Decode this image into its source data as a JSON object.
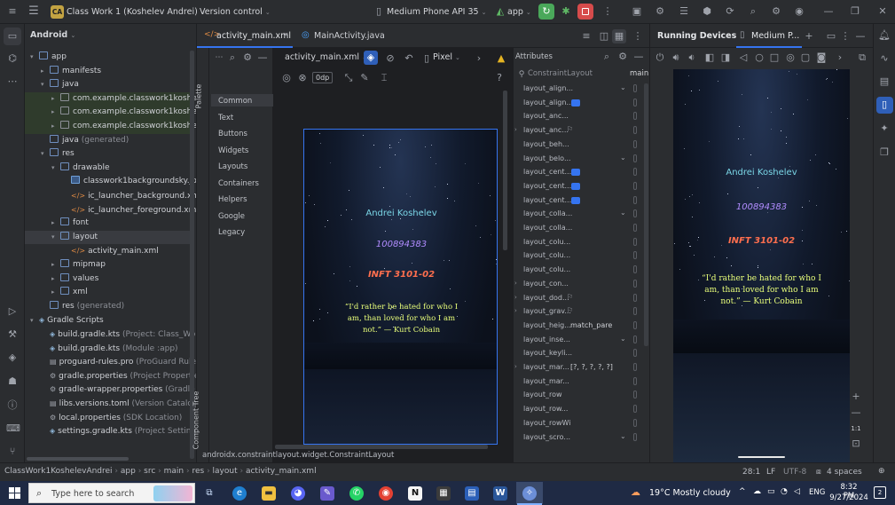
{
  "titlebar": {
    "project_badge": "CA",
    "project_name": "Class Work 1 (Koshelev Andrei)",
    "vcs": "Version control",
    "device": "Medium Phone API 35",
    "run_config": "app"
  },
  "project_panel": {
    "view": "Android",
    "items": [
      {
        "label": "app",
        "indent": 0,
        "arrow": "open",
        "kind": "folder"
      },
      {
        "label": "manifests",
        "indent": 1,
        "arrow": "closed",
        "kind": "folder"
      },
      {
        "label": "java",
        "indent": 1,
        "arrow": "open",
        "kind": "folder"
      },
      {
        "label": "com.example.classwork1koshelev",
        "indent": 2,
        "arrow": "closed",
        "kind": "pkg",
        "hl": true
      },
      {
        "label": "com.example.classwork1koshelev",
        "indent": 2,
        "arrow": "closed",
        "kind": "pkg",
        "hl": true
      },
      {
        "label": "com.example.classwork1koshelev",
        "indent": 2,
        "arrow": "closed",
        "kind": "pkg",
        "hl": true
      },
      {
        "label": "java",
        "suffix": "(generated)",
        "indent": 1,
        "arrow": "none",
        "kind": "folder"
      },
      {
        "label": "res",
        "indent": 1,
        "arrow": "open",
        "kind": "folder"
      },
      {
        "label": "drawable",
        "indent": 2,
        "arrow": "open",
        "kind": "folder"
      },
      {
        "label": "classwork1backgroundsky.jpg",
        "indent": 3,
        "arrow": "none",
        "kind": "img"
      },
      {
        "label": "ic_launcher_background.xml",
        "indent": 3,
        "arrow": "none",
        "kind": "xml"
      },
      {
        "label": "ic_launcher_foreground.xml",
        "indent": 3,
        "arrow": "none",
        "kind": "xml"
      },
      {
        "label": "font",
        "indent": 2,
        "arrow": "closed",
        "kind": "folder"
      },
      {
        "label": "layout",
        "indent": 2,
        "arrow": "open",
        "kind": "folder",
        "sel": true
      },
      {
        "label": "activity_main.xml",
        "indent": 3,
        "arrow": "none",
        "kind": "xml"
      },
      {
        "label": "mipmap",
        "indent": 2,
        "arrow": "closed",
        "kind": "folder"
      },
      {
        "label": "values",
        "indent": 2,
        "arrow": "closed",
        "kind": "folder"
      },
      {
        "label": "xml",
        "indent": 2,
        "arrow": "closed",
        "kind": "folder"
      },
      {
        "label": "res",
        "suffix": "(generated)",
        "indent": 1,
        "arrow": "none",
        "kind": "folder"
      },
      {
        "label": "Gradle Scripts",
        "indent": 0,
        "arrow": "open",
        "kind": "gradle"
      },
      {
        "label": "build.gradle.kts",
        "suffix": "(Project: Class_Work",
        "indent": 1,
        "arrow": "none",
        "kind": "gradle"
      },
      {
        "label": "build.gradle.kts",
        "suffix": "(Module :app)",
        "indent": 1,
        "arrow": "none",
        "kind": "gradle"
      },
      {
        "label": "proguard-rules.pro",
        "suffix": "(ProGuard Rules",
        "indent": 1,
        "arrow": "none",
        "kind": "file"
      },
      {
        "label": "gradle.properties",
        "suffix": "(Project Properties",
        "indent": 1,
        "arrow": "none",
        "kind": "gear"
      },
      {
        "label": "gradle-wrapper.properties",
        "suffix": "(Gradle V",
        "indent": 1,
        "arrow": "none",
        "kind": "gear"
      },
      {
        "label": "libs.versions.toml",
        "suffix": "(Version Catalog",
        "indent": 1,
        "arrow": "none",
        "kind": "file"
      },
      {
        "label": "local.properties",
        "suffix": "(SDK Location)",
        "indent": 1,
        "arrow": "none",
        "kind": "gear"
      },
      {
        "label": "settings.gradle.kts",
        "suffix": "(Project Settings",
        "indent": 1,
        "arrow": "none",
        "kind": "gradle"
      }
    ]
  },
  "editor": {
    "tabs": [
      {
        "label": "activity_main.xml",
        "active": true
      },
      {
        "label": "MainActivity.java",
        "active": false
      }
    ],
    "palette_label": "Palette",
    "component_tree_label": "Component Tree",
    "palette": [
      "Common",
      "Text",
      "Buttons",
      "Widgets",
      "Layouts",
      "Containers",
      "Helpers",
      "Google",
      "Legacy"
    ],
    "toolbar_file": "activity_main.xml",
    "toolbar_device": "Pixel",
    "margin": "0dp",
    "breadcrumb": "androidx.constraintlayout.widget.ConstraintLayout"
  },
  "attributes": {
    "title": "Attributes",
    "class_name": "ConstraintLayout",
    "id_value": "main",
    "rows": [
      {
        "name": "layout_align...",
        "ctrl": "chev"
      },
      {
        "name": "layout_align...",
        "ctrl": "check"
      },
      {
        "name": "layout_anc...",
        "ctrl": "box"
      },
      {
        "name": "layout_anc...",
        "ctrl": "flag",
        "expand": true
      },
      {
        "name": "layout_beh...",
        "ctrl": "box"
      },
      {
        "name": "layout_belo...",
        "ctrl": "chev"
      },
      {
        "name": "layout_cent...",
        "ctrl": "check"
      },
      {
        "name": "layout_cent...",
        "ctrl": "check"
      },
      {
        "name": "layout_cent...",
        "ctrl": "check"
      },
      {
        "name": "layout_colla...",
        "ctrl": "chev"
      },
      {
        "name": "layout_colla...",
        "ctrl": "box"
      },
      {
        "name": "layout_colu...",
        "ctrl": "box"
      },
      {
        "name": "layout_colu...",
        "ctrl": "box"
      },
      {
        "name": "layout_colu...",
        "ctrl": "box"
      },
      {
        "name": "layout_con...",
        "ctrl": "box",
        "expand": true
      },
      {
        "name": "layout_dod...",
        "ctrl": "flag",
        "expand": true
      },
      {
        "name": "layout_grav...",
        "ctrl": "flag",
        "expand": true
      },
      {
        "name": "layout_heig...",
        "ctrl": "value",
        "value": "match_pare"
      },
      {
        "name": "layout_inse...",
        "ctrl": "chev"
      },
      {
        "name": "layout_keyli...",
        "ctrl": "box"
      },
      {
        "name": "layout_mar...",
        "ctrl": "value",
        "value": "[?, ?, ?, ?, ?]",
        "expand": true
      },
      {
        "name": "layout_mar...",
        "ctrl": "box"
      },
      {
        "name": "layout_row",
        "ctrl": "box"
      },
      {
        "name": "layout_row...",
        "ctrl": "box"
      },
      {
        "name": "layout_rowWi",
        "ctrl": "box"
      },
      {
        "name": "layout_scro...",
        "ctrl": "chev"
      }
    ]
  },
  "phone_content": {
    "name": "Andrei Koshelev",
    "student_id": "100894383",
    "course": "INFT 3101-02",
    "quote": "“I'd rather be hated for who I am, than loved for who I am not.” — Kurt Cobain"
  },
  "running_devices": {
    "title": "Running Devices",
    "device_tab": "Medium P...",
    "zoom": "1:1"
  },
  "statusbar": {
    "path": [
      "ClassWork1KoshelevAndrei",
      "app",
      "src",
      "main",
      "res",
      "layout",
      "activity_main.xml"
    ],
    "position": "28:1",
    "line_sep": "LF",
    "encoding": "UTF-8",
    "indent": "4 spaces"
  },
  "taskbar": {
    "search_placeholder": "Type here to search",
    "weather": "19°C  Mostly cloudy",
    "lang": "ENG",
    "time": "8:32 PM",
    "date": "9/27/2024",
    "notifications": "2"
  },
  "colors": {
    "accent": "#3574f0",
    "name_text": "#7ad6e6",
    "id_text": "#b18cff",
    "course_text": "#ff6f4e",
    "quote_text": "#e9ff7a"
  }
}
